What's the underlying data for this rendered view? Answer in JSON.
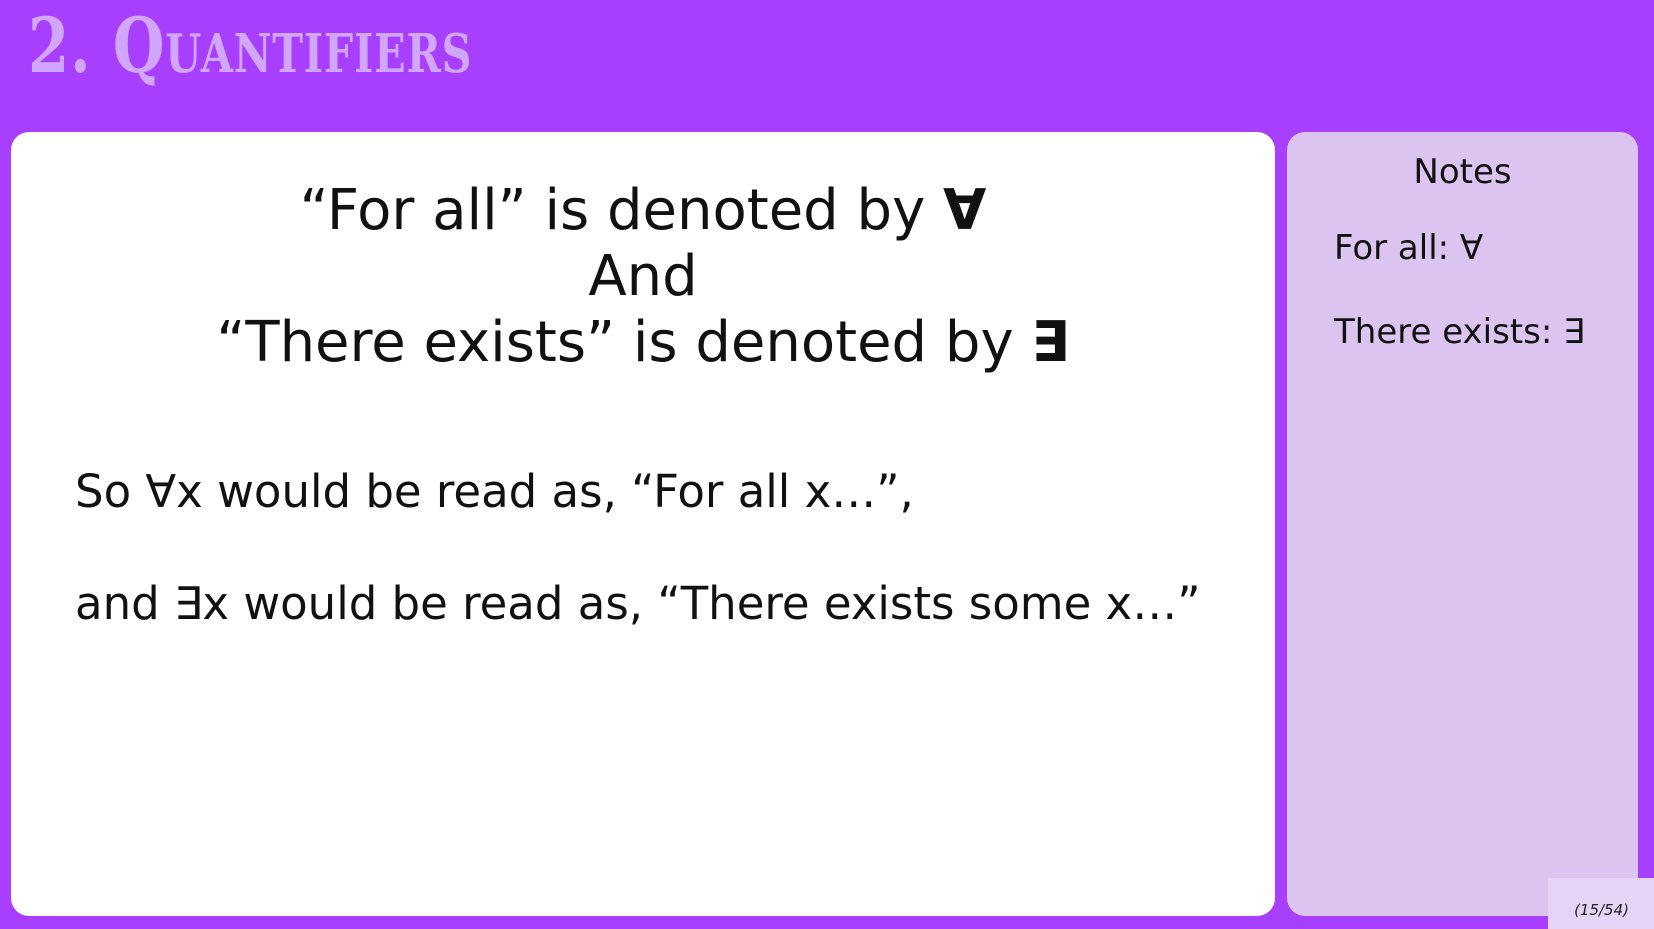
{
  "slide": {
    "title": "2. Quantifiers"
  },
  "main": {
    "headline_line_1": "“For all” is denoted by ",
    "headline_symbol_1": "∀",
    "headline_line_2": "And",
    "headline_line_3": "“There exists” is denoted by ",
    "headline_symbol_2": "∃",
    "reading_1": "So ∀x would be read as, “For all x…”,",
    "reading_2": "and ∃x would be read as, “There exists some x…”"
  },
  "notes": {
    "title": "Notes",
    "item_1": "For all: ∀",
    "item_2": "There exists: ∃"
  },
  "page_counter": "(15/54)"
}
